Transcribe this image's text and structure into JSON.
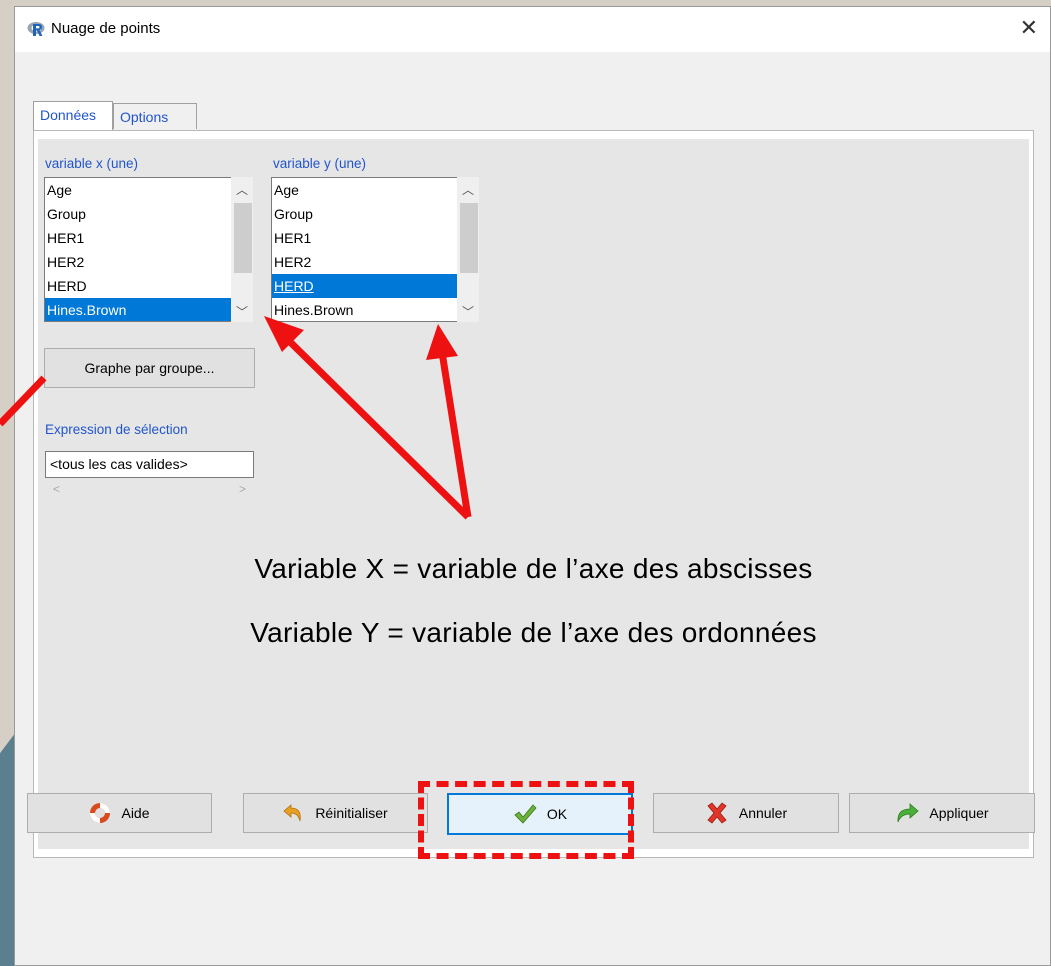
{
  "window": {
    "title": "Nuage de points"
  },
  "tabs": [
    {
      "label": "Données"
    },
    {
      "label": "Options"
    }
  ],
  "xvar": {
    "label": "variable x (une)",
    "items": [
      "Age",
      "Group",
      "HER1",
      "HER2",
      "HERD",
      "Hines.Brown"
    ],
    "selected": "Hines.Brown"
  },
  "yvar": {
    "label": "variable y (une)",
    "items": [
      "Age",
      "Group",
      "HER1",
      "HER2",
      "HERD",
      "Hines.Brown"
    ],
    "selected": "HERD"
  },
  "group_button": "Graphe par groupe...",
  "subset": {
    "label": "Expression de sélection",
    "value": "<tous les cas valides>"
  },
  "annotation": {
    "line1": "Variable X = variable de l’axe des abscisses",
    "line2": "Variable Y = variable de l’axe des ordonnées"
  },
  "buttons": {
    "help": "Aide",
    "reset": "Réinitialiser",
    "ok": "OK",
    "cancel": "Annuler",
    "apply": "Appliquer"
  },
  "icons": {
    "app": "r-logo-icon",
    "help": "lifebuoy-icon",
    "reset": "undo-arrow-icon",
    "ok": "green-check-icon",
    "cancel": "red-x-icon",
    "apply": "green-redo-arrow-icon"
  },
  "colors": {
    "accent": "#0078d7",
    "label_blue": "#2255cc",
    "annotation_red": "#ee1111"
  }
}
